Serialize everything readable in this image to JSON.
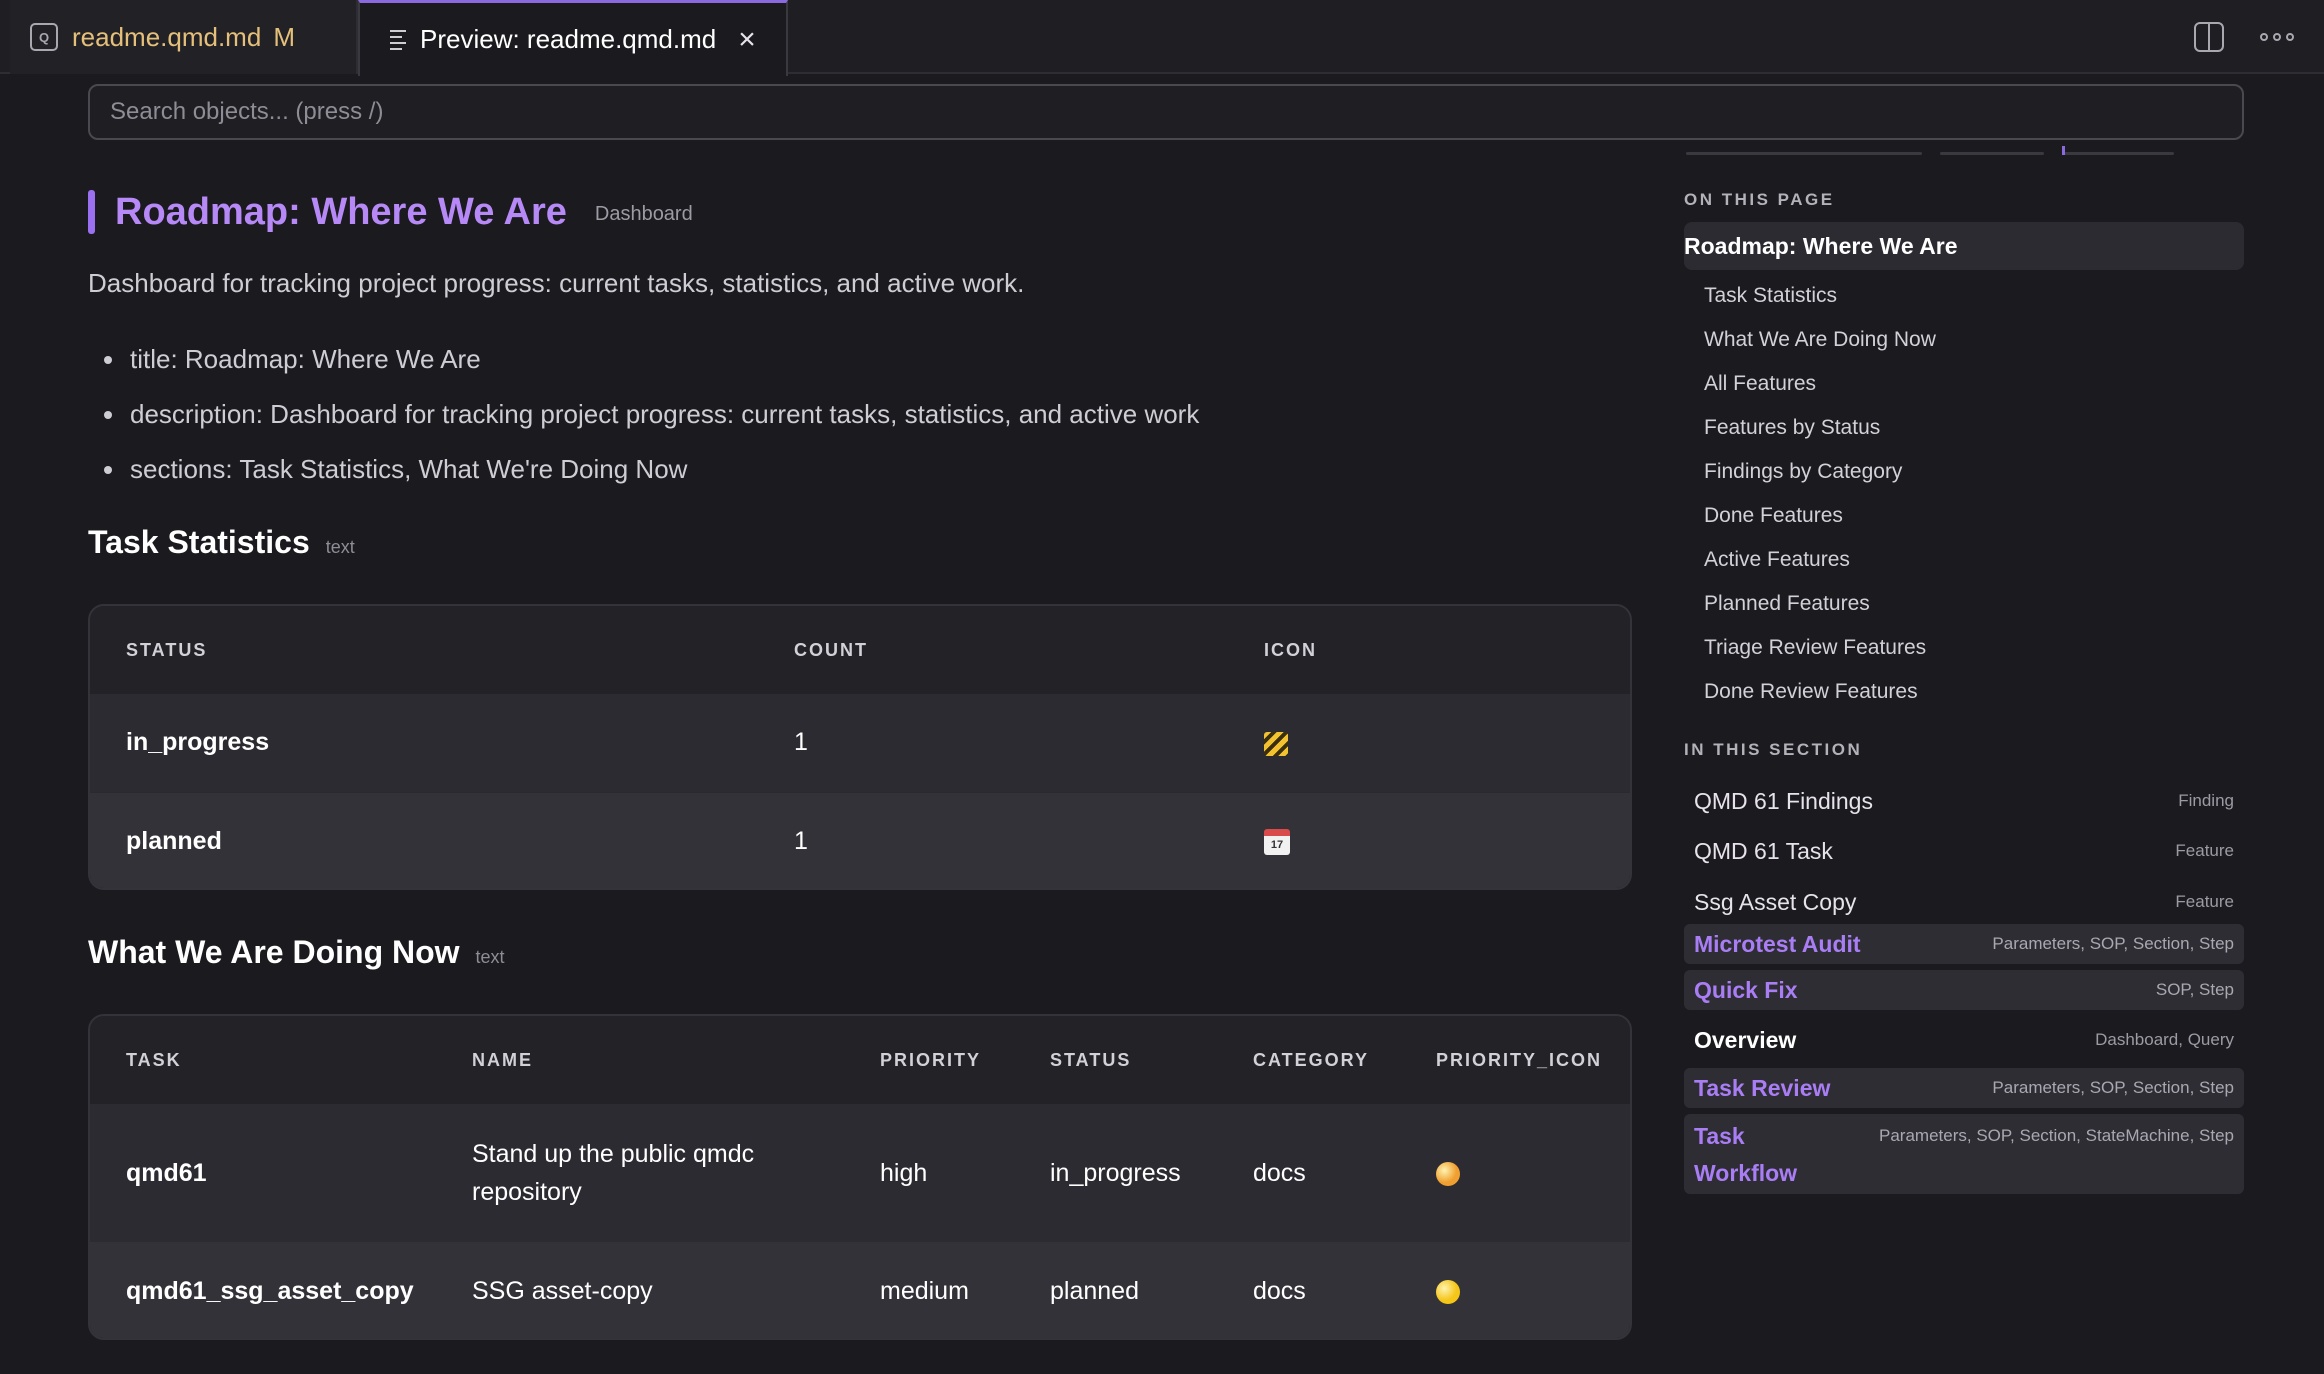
{
  "tabs": [
    {
      "icon": "quarto-file-icon",
      "badge": "Q",
      "label": "readme.qmd.md",
      "modified": "M"
    },
    {
      "icon": "preview-lines-icon",
      "label": "Preview: readme.qmd.md",
      "close": "×"
    }
  ],
  "search": {
    "placeholder": "Search objects... (press /)"
  },
  "page": {
    "title": "Roadmap: Where We Are",
    "type_badge": "Dashboard",
    "description": "Dashboard for tracking project progress: current tasks, statistics, and active work.",
    "meta": [
      "title: Roadmap: Where We Are",
      "description: Dashboard for tracking project progress: current tasks, statistics, and active work",
      "sections: Task Statistics, What We're Doing Now"
    ]
  },
  "task_statistics": {
    "title": "Task Statistics",
    "tag": "text",
    "columns": [
      "STATUS",
      "COUNT",
      "ICON"
    ],
    "rows": [
      {
        "status": "in_progress",
        "count": "1",
        "icon": "construction-icon"
      },
      {
        "status": "planned",
        "count": "1",
        "icon": "calendar-icon",
        "icon_text": "17"
      }
    ]
  },
  "doing_now": {
    "title": "What We Are Doing Now",
    "tag": "text",
    "columns": [
      "TASK",
      "NAME",
      "PRIORITY",
      "STATUS",
      "CATEGORY",
      "PRIORITY_ICON"
    ],
    "rows": [
      {
        "task": "qmd61",
        "name": "Stand up the public qmdc repository",
        "priority": "high",
        "status": "in_progress",
        "category": "docs",
        "priority_color": "#f0a030"
      },
      {
        "task": "qmd61_ssg_asset_copy",
        "name": "SSG asset-copy",
        "priority": "medium",
        "status": "planned",
        "category": "docs",
        "priority_color": "#f5c518"
      }
    ]
  },
  "sidebar": {
    "on_this_page_label": "ON THIS PAGE",
    "toc_active": "Roadmap: Where We Are",
    "toc": [
      "Task Statistics",
      "What We Are Doing Now",
      "All Features",
      "Features by Status",
      "Findings by Category",
      "Done Features",
      "Active Features",
      "Planned Features",
      "Triage Review Features",
      "Done Review Features"
    ],
    "in_this_section_label": "IN THIS SECTION",
    "section_items": [
      {
        "name": "QMD 61 Findings",
        "type": "Finding"
      },
      {
        "name": "QMD 61 Task",
        "type": "Feature"
      },
      {
        "name": "Ssg Asset Copy",
        "type": "Feature"
      },
      {
        "name": "Microtest Audit",
        "type": "Parameters, SOP, Section, Step"
      },
      {
        "name": "Quick Fix",
        "type": "SOP, Step"
      },
      {
        "name": "Overview",
        "type": "Dashboard, Query"
      },
      {
        "name": "Task Review",
        "type": "Parameters, SOP, Section, Step"
      },
      {
        "name_line1": "Task",
        "name_line2": "Workflow",
        "type": "Parameters, SOP, Section, StateMachine, Step"
      }
    ]
  },
  "colors": {
    "accent": "#b689f7",
    "background": "#1b1a1f"
  }
}
